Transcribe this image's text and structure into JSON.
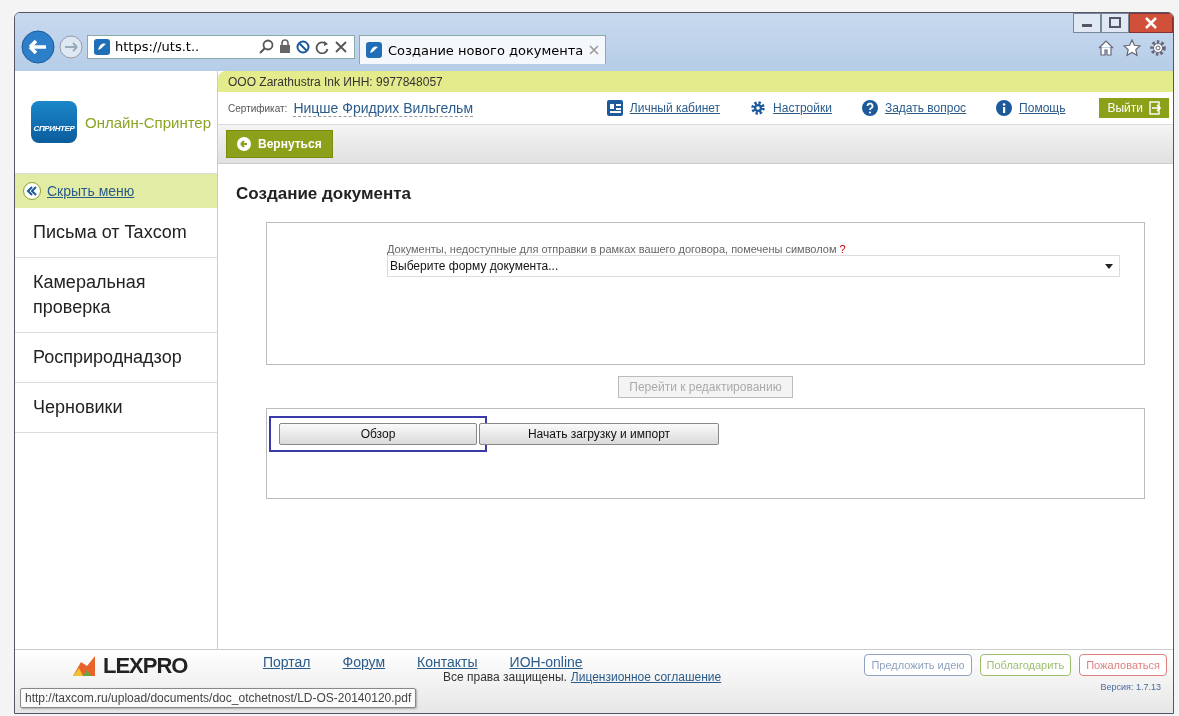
{
  "browser": {
    "address": "https://uts.t..",
    "tab_title": "Создание нового документа",
    "status_url": "http://taxcom.ru/upload/documents/doc_otchetnost/LD-OS-20140120.pdf"
  },
  "app": {
    "name": "Онлайн-Спринтер",
    "logo_text": "СПРИНТЕР"
  },
  "company": "ООО Zarathustra Ink ИНН: 9977848057",
  "certificate": {
    "label": "Сертификат:",
    "name": "Ницше Фридрих Вильгельм"
  },
  "top_links": [
    {
      "label": "Личный кабинет",
      "kind": "card"
    },
    {
      "label": "Настройки",
      "kind": "gear"
    },
    {
      "label": "Задать вопрос",
      "kind": "question"
    },
    {
      "label": "Помощь",
      "kind": "info"
    }
  ],
  "logout": "Выйти",
  "back_button": "Вернуться",
  "sidebar": {
    "hide_menu": "Скрыть меню",
    "items": [
      "Письма от Taxcom",
      "Камеральная проверка",
      "Росприроднадзор",
      "Черновики"
    ]
  },
  "page_title": "Создание документа",
  "form": {
    "hint": "Документы, недоступные для отправки в рамках вашего договора, помечены символом",
    "hint_mark": "?",
    "select_value": "Выберите форму документа...",
    "edit_button": {
      "label": "Перейти к редактированию",
      "disabled": true
    }
  },
  "upload": {
    "browse_button": {
      "label": "Обзор",
      "highlighted": true
    },
    "import_button": "Начать загрузку и импорт"
  },
  "footer": {
    "brand": "LEXPRO",
    "links": [
      "Портал",
      "Форум",
      "Контакты",
      "ИОН-online"
    ],
    "copyright": "Все права защищены.",
    "license_link": "Лицензионное соглашение",
    "actions": [
      {
        "label": "Предложить идею",
        "color": "#8fa3bf"
      },
      {
        "label": "Поблагодарить",
        "color": "#9cbf6e"
      },
      {
        "label": "Пожаловаться",
        "color": "#e08080"
      }
    ],
    "version": "Версия: 1.7.13"
  }
}
